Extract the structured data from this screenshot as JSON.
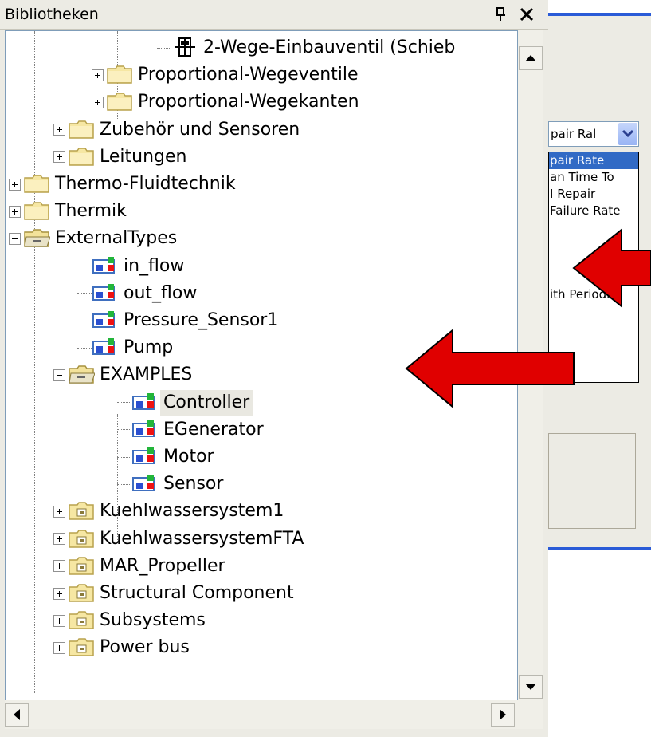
{
  "panel": {
    "title": "Bibliotheken",
    "pin_icon": "pin-icon",
    "close_icon": "close-icon"
  },
  "tree": {
    "items": [
      {
        "label": "2-Wege-Einbauventil (Schieb",
        "icon": "valve-icon"
      },
      {
        "label": "Proportional-Wegeventile",
        "icon": "folder-icon"
      },
      {
        "label": "Proportional-Wegekanten",
        "icon": "folder-icon"
      },
      {
        "label": "Zubehör und Sensoren",
        "icon": "folder-icon"
      },
      {
        "label": "Leitungen",
        "icon": "folder-icon"
      },
      {
        "label": "Thermo-Fluidtechnik",
        "icon": "folder-icon"
      },
      {
        "label": "Thermik",
        "icon": "folder-icon"
      },
      {
        "label": "ExternalTypes",
        "icon": "open-folder-icon"
      },
      {
        "label": "in_flow",
        "icon": "component-icon"
      },
      {
        "label": "out_flow",
        "icon": "component-icon"
      },
      {
        "label": "Pressure_Sensor1",
        "icon": "component-icon"
      },
      {
        "label": "Pump",
        "icon": "component-icon"
      },
      {
        "label": "EXAMPLES",
        "icon": "open-folder-icon"
      },
      {
        "label": "Controller",
        "icon": "component-icon"
      },
      {
        "label": "EGenerator",
        "icon": "component-icon"
      },
      {
        "label": "Motor",
        "icon": "component-icon"
      },
      {
        "label": "Sensor",
        "icon": "component-icon"
      },
      {
        "label": "Kuehlwassersystem1",
        "icon": "model-folder-icon"
      },
      {
        "label": "KuehlwassersystemFTA",
        "icon": "model-folder-icon"
      },
      {
        "label": "MAR_Propeller",
        "icon": "model-folder-icon"
      },
      {
        "label": "Structural Component",
        "icon": "model-folder-icon"
      },
      {
        "label": "Subsystems",
        "icon": "model-folder-icon"
      },
      {
        "label": "Power bus",
        "icon": "model-folder-icon"
      }
    ],
    "selected": "Controller"
  },
  "dialog": {
    "combo_value": "pair Ral",
    "dropdown_items": [
      "pair Rate",
      "an Time To",
      "I Repair",
      "Failure Rate",
      "",
      "",
      "",
      "",
      "ith Periodic"
    ],
    "selected_item": "pair Rate"
  },
  "colors": {
    "arrow": "#e00000",
    "selection": "#316ac5",
    "dialog_accent": "#2a5bd7"
  }
}
